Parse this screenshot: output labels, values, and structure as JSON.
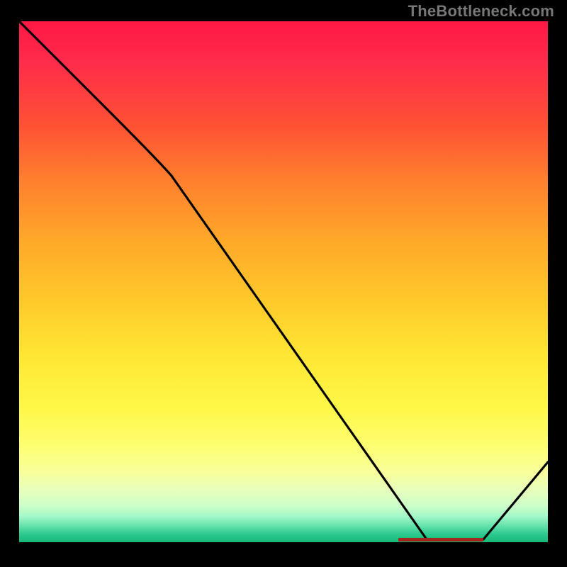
{
  "watermark": "TheBottleneck.com",
  "chart_data": {
    "type": "line",
    "title": "",
    "xlabel": "",
    "ylabel": "",
    "x": [
      0,
      28,
      77,
      87,
      100
    ],
    "values": [
      100,
      80,
      0,
      0,
      15
    ],
    "xlim": [
      0,
      100
    ],
    "ylim": [
      0,
      100
    ],
    "annotations": [
      {
        "x_range": [
          72,
          88
        ],
        "y": 0,
        "label": "optimum-segment"
      }
    ],
    "gradient_stops": [
      {
        "pos": 0.0,
        "color": "#ff1846"
      },
      {
        "pos": 0.2,
        "color": "#ff5134"
      },
      {
        "pos": 0.42,
        "color": "#ffa829"
      },
      {
        "pos": 0.64,
        "color": "#ffe633"
      },
      {
        "pos": 0.82,
        "color": "#fdff73"
      },
      {
        "pos": 0.93,
        "color": "#cdffc8"
      },
      {
        "pos": 1.0,
        "color": "#14b978"
      }
    ]
  }
}
